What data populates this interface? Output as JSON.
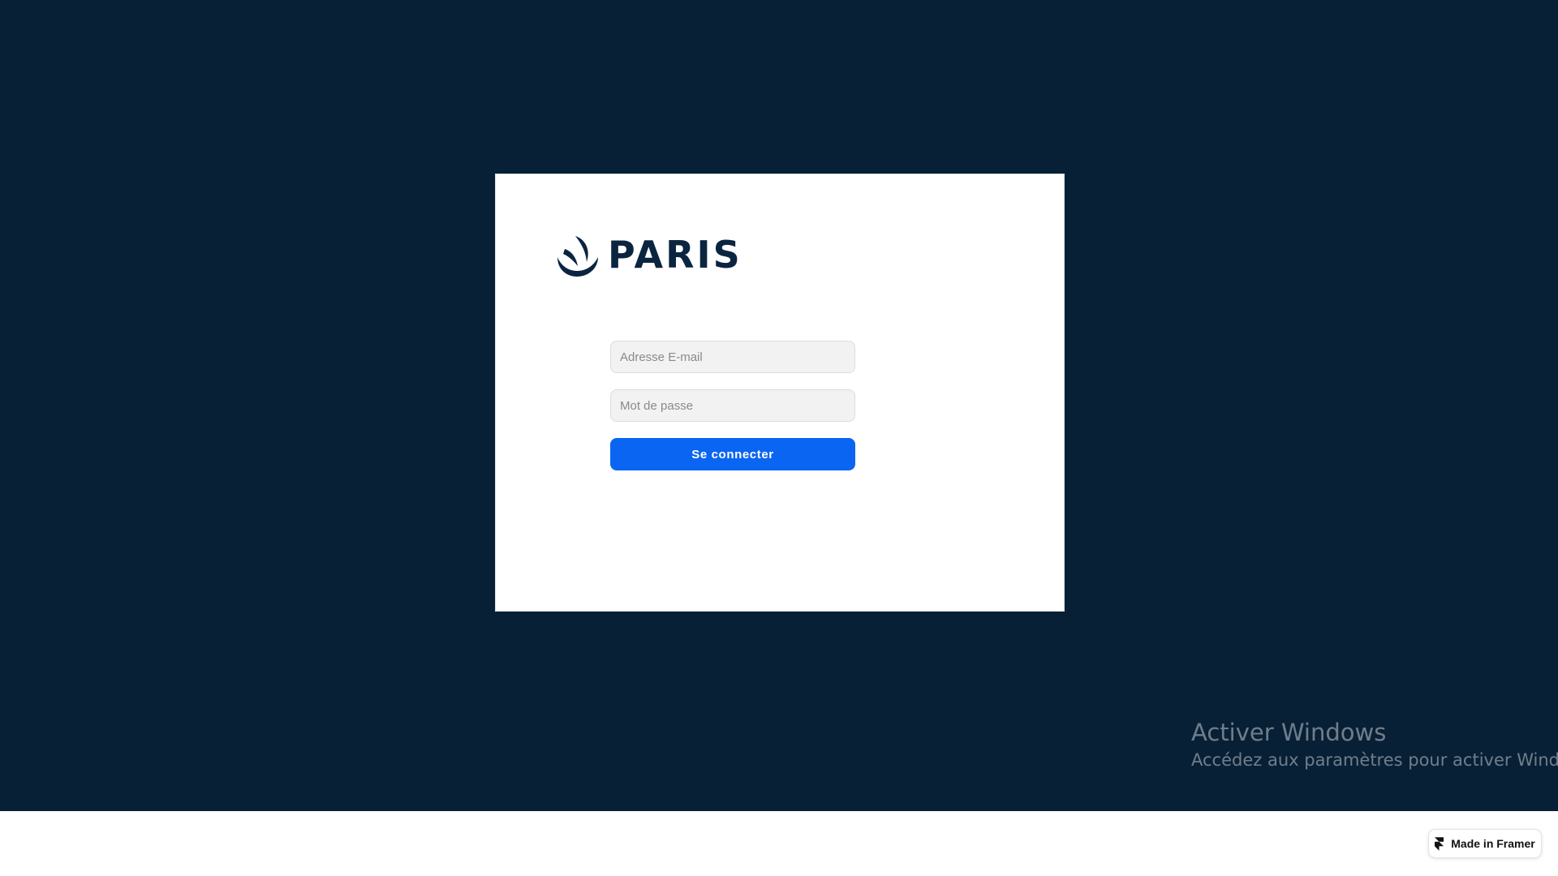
{
  "brand": {
    "logo_text": "PARIS",
    "logo_color": "#0b2540"
  },
  "login_form": {
    "email_placeholder": "Adresse E-mail",
    "email_value": "",
    "password_placeholder": "Mot de passe",
    "password_value": "",
    "submit_label": "Se connecter",
    "accent_color": "#0a66f2"
  },
  "windows_watermark": {
    "title": "Activer Windows",
    "subtitle": "Accédez aux paramètres pour activer Windows."
  },
  "framer_badge": {
    "label": "Made in Framer",
    "icon": "framer-icon"
  },
  "colors": {
    "background": "#082036",
    "card": "#ffffff"
  }
}
